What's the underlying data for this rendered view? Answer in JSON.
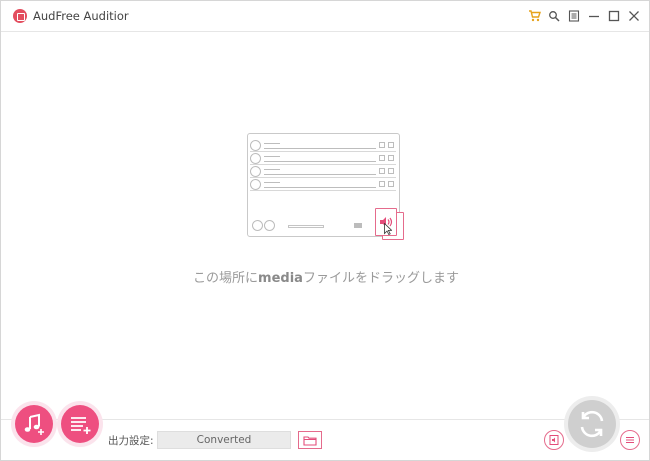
{
  "window": {
    "title": "AudFree Auditior"
  },
  "titlebar": {
    "icons": [
      "cart-icon",
      "search-icon",
      "register-icon",
      "minimize-icon",
      "maximize-icon",
      "close-icon"
    ]
  },
  "dropzone": {
    "text_prefix": "この場所に",
    "text_bold": "media",
    "text_suffix": "ファイルをドラッグします"
  },
  "bottombar": {
    "output_label": "出力設定:",
    "output_value": "Converted"
  },
  "colors": {
    "accent": "#ee4f80",
    "cart": "#e6a21b",
    "convert_disabled": "#cfcfcf"
  }
}
